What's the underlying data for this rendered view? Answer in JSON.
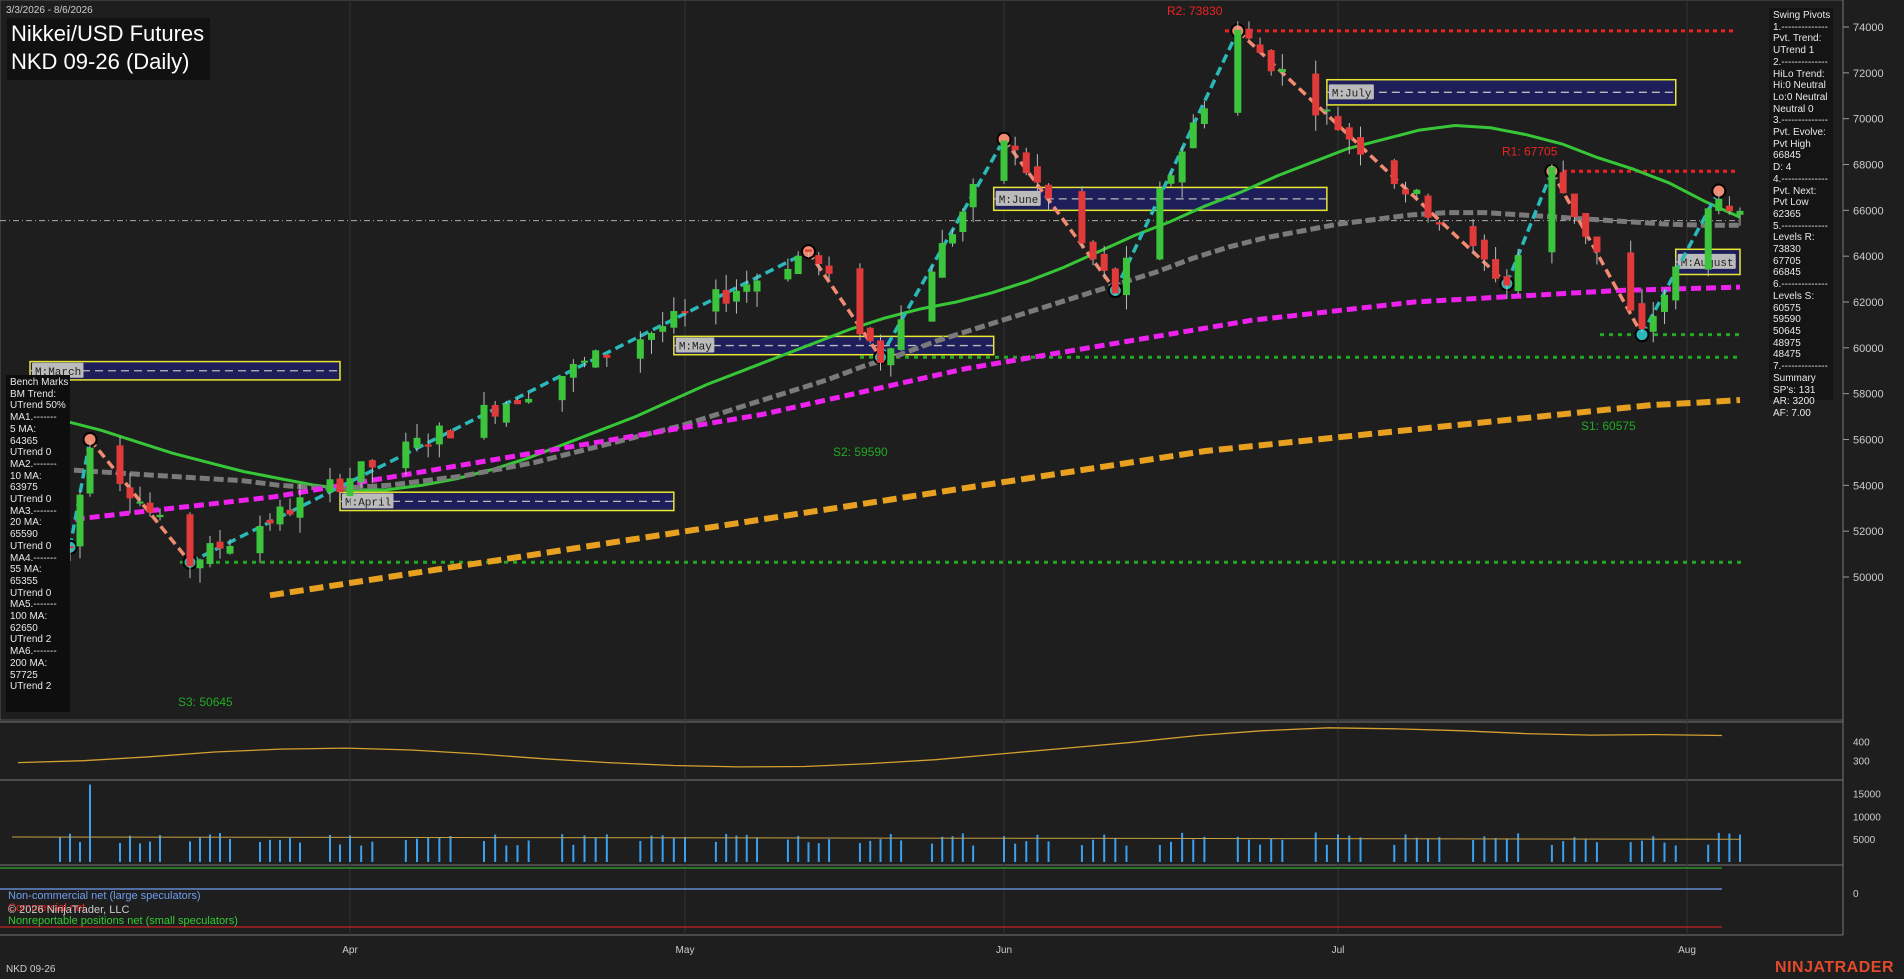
{
  "header": {
    "date_range": "3/3/2026 - 8/6/2026",
    "title_line1": "Nikkei/USD Futures",
    "title_line2": "NKD 09-26 (Daily)"
  },
  "footer": {
    "symbol": "NKD 09-26",
    "copyright": "© 2026 NinjaTrader, LLC",
    "brand": "NINJATRADER"
  },
  "swing_pivots": [
    "Swing Pivots",
    "1.--------------",
    "Pvt. Trend:",
    "UTrend 1",
    "2.--------------",
    "HiLo Trend:",
    "Hi:0 Neutral",
    "Lo:0 Neutral",
    "Neutral 0",
    "3.--------------",
    "Pvt. Evolve:",
    "Pvt High",
    "66845",
    "D: 4",
    "4.--------------",
    "Pvt. Next:",
    "Pvt Low",
    "62365",
    "5.--------------",
    "Levels R:",
    "73830",
    "67705",
    "66845",
    "6.--------------",
    "Levels S:",
    "60575",
    "59590",
    "50645",
    "48975",
    "48475",
    "7.--------------",
    "Summary",
    "SP's: 131",
    "AR: 3200",
    "AF: 7.00"
  ],
  "bench_marks": [
    "Bench Marks",
    "BM Trend:",
    "UTrend 50%",
    "MA1.-------",
    "5 MA:",
    "64365",
    "UTrend 0",
    "MA2.-------",
    "10 MA:",
    "63975",
    "UTrend 0",
    "MA3.-------",
    "20 MA:",
    "65590",
    "UTrend 0",
    "MA4.-------",
    "55 MA:",
    "65355",
    "UTrend 0",
    "MA5.-------",
    "100 MA:",
    "62650",
    "UTrend 2",
    "MA6.-------",
    "200 MA:",
    "57725",
    "UTrend 2"
  ],
  "cot_legend": {
    "noncommercial": "Non-commercial net (large speculators)",
    "commercial": "Commercial net",
    "nonreportable": "Nonreportable positions net (small speculators)"
  },
  "colors": {
    "background": "#1e1e1e",
    "up_candle": "#3dc43d",
    "down_candle": "#e03a3a",
    "ma_green": "#37c637",
    "ma_gray": "#7a7a7a",
    "ma_magenta": "#ee22ee",
    "ma_orange": "#e8a020",
    "swing_up": "#2ab8b8",
    "swing_down": "#f08a70",
    "resistance": "#ee2222",
    "support": "#22aa22",
    "volume": "#3aa0f0",
    "zone_fill": "#1e1e5a",
    "zone_border": "#e8e830"
  },
  "chart_data": {
    "type": "candlestick",
    "title": "NKD 09-26 (Daily)",
    "x_range": [
      "2026-03-03",
      "2026-08-06"
    ],
    "x_ticks": [
      "Apr",
      "May",
      "Jun",
      "Jul",
      "Aug"
    ],
    "y_ticks": [
      50000,
      52000,
      54000,
      56000,
      58000,
      60000,
      62000,
      64000,
      66000,
      68000,
      70000,
      72000,
      74000
    ],
    "ylim": [
      49500,
      75000
    ],
    "last_price": 65550,
    "resistance_levels": [
      {
        "label": "R2: 73830",
        "value": 73830
      },
      {
        "label": "R1: 67705",
        "value": 67705
      }
    ],
    "support_levels": [
      {
        "label": "S1: 60575",
        "value": 60575
      },
      {
        "label": "S2: 59590",
        "value": 59590
      },
      {
        "label": "S3: 50645",
        "value": 50645
      }
    ],
    "swing_points": [
      {
        "date": "2026-03-04",
        "value": 51300
      },
      {
        "date": "2026-03-06",
        "value": 56000
      },
      {
        "date": "2026-03-16",
        "value": 50645
      },
      {
        "date": "2026-05-13",
        "value": 64200
      },
      {
        "date": "2026-05-20",
        "value": 59590
      },
      {
        "date": "2026-06-01",
        "value": 69100
      },
      {
        "date": "2026-06-11",
        "value": 62500
      },
      {
        "date": "2026-06-22",
        "value": 73830
      },
      {
        "date": "2026-07-16",
        "value": 62800
      },
      {
        "date": "2026-07-20",
        "value": 67705
      },
      {
        "date": "2026-07-28",
        "value": 60575
      },
      {
        "date": "2026-08-04",
        "value": 66845
      }
    ],
    "vwap_zones": [
      {
        "label": "M:March",
        "start": "2026-02-28",
        "end": "2026-03-31",
        "low": 58600,
        "high": 59400
      },
      {
        "label": "M:April",
        "start": "2026-03-31",
        "end": "2026-04-30",
        "low": 52900,
        "high": 53700
      },
      {
        "label": "M:May",
        "start": "2026-04-30",
        "end": "2026-05-31",
        "low": 59700,
        "high": 60500
      },
      {
        "label": "M:June",
        "start": "2026-05-31",
        "end": "2026-06-30",
        "low": 66000,
        "high": 67000
      },
      {
        "label": "M:July",
        "start": "2026-06-30",
        "end": "2026-07-31",
        "low": 70600,
        "high": 71700
      },
      {
        "label": "M:August",
        "start": "2026-07-31",
        "end": "2026-08-06",
        "low": 63200,
        "high": 64300
      }
    ],
    "series": [
      {
        "name": "20 MA",
        "values": [
          57100,
          56800,
          56400,
          55900,
          55400,
          55000,
          54600,
          54300,
          54000,
          53800,
          53800,
          54000,
          54300,
          54700,
          55200,
          55800,
          56400,
          57000,
          57700,
          58400,
          59000,
          59600,
          60200,
          60800,
          61300,
          61700,
          62000,
          62400,
          62900,
          63500,
          64200,
          64900,
          65500,
          66200,
          66800,
          67500,
          68100,
          68700,
          69100,
          69500,
          69700,
          69600,
          69300,
          68900,
          68300,
          67800,
          67200,
          66400,
          65700
        ]
      },
      {
        "name": "55 MA",
        "values": [
          54700,
          54600,
          54500,
          54400,
          54300,
          54200,
          54000,
          53900,
          53900,
          54000,
          54200,
          54400,
          54700,
          55000,
          55400,
          55800,
          56200,
          56600,
          57100,
          57600,
          58100,
          58600,
          59200,
          59700,
          60300,
          60800,
          61300,
          61800,
          62300,
          62800,
          63300,
          63900,
          64400,
          64800,
          65100,
          65400,
          65600,
          65800,
          65900,
          65900,
          65800,
          65700,
          65600,
          65500,
          65400,
          65350,
          65350
        ]
      },
      {
        "name": "100 MA",
        "values": [
          52300,
          52500,
          52700,
          52900,
          53100,
          53300,
          53500,
          53800,
          54100,
          54400,
          54700,
          55000,
          55300,
          55600,
          55900,
          56200,
          56500,
          56800,
          57100,
          57500,
          57900,
          58300,
          58700,
          59100,
          59400,
          59700,
          60000,
          60300,
          60600,
          60900,
          61200,
          61400,
          61600,
          61800,
          62000,
          62100,
          62200,
          62300,
          62400,
          62500,
          62550,
          62600,
          62650
        ]
      },
      {
        "name": "200 MA",
        "values": [
          49200,
          49500,
          49800,
          50100,
          50400,
          50700,
          51000,
          51300,
          51600,
          51900,
          52200,
          52500,
          52800,
          53100,
          53400,
          53700,
          54000,
          54300,
          54600,
          54900,
          55200,
          55500,
          55700,
          55900,
          56100,
          56300,
          56500,
          56700,
          56900,
          57100,
          57300,
          57500,
          57600,
          57725
        ]
      }
    ],
    "lower_panels": [
      {
        "name": "ATR",
        "ylim": [
          200,
          500
        ],
        "y_ticks": [
          300,
          400
        ]
      },
      {
        "name": "Volume",
        "ylim": [
          0,
          18000
        ],
        "y_ticks": [
          5000,
          10000,
          15000
        ]
      },
      {
        "name": "COT",
        "y_ticks": [
          0
        ]
      }
    ]
  }
}
